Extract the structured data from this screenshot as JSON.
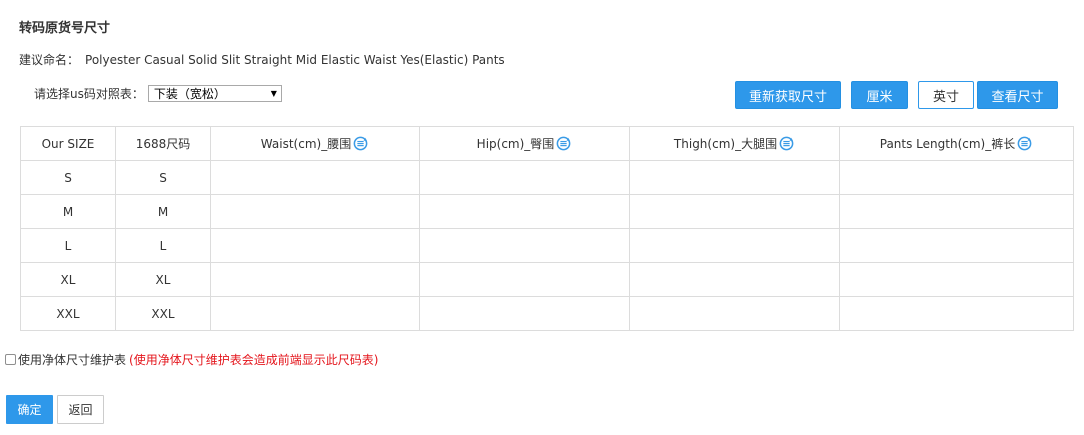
{
  "title": "转码原货号尺寸",
  "suggest": {
    "label": "建议命名：",
    "value": "Polyester Casual Solid Slit Straight Mid Elastic Waist Yes(Elastic) Pants"
  },
  "size_chart_select": {
    "label": "请选择us码对照表：",
    "selected": "下装（宽松）"
  },
  "buttons": {
    "refetch": "重新获取尺寸",
    "cm": "厘米",
    "inch": "英寸",
    "view": "查看尺寸"
  },
  "table": {
    "headers": [
      "Our SIZE",
      "1688尺码",
      "Waist(cm)_腰围",
      "Hip(cm)_臀围",
      "Thigh(cm)_大腿围",
      "Pants Length(cm)_裤长"
    ],
    "rows": [
      [
        "S",
        "S",
        "",
        "",
        "",
        ""
      ],
      [
        "M",
        "M",
        "",
        "",
        "",
        ""
      ],
      [
        "L",
        "L",
        "",
        "",
        "",
        ""
      ],
      [
        "XL",
        "XL",
        "",
        "",
        "",
        ""
      ],
      [
        "XXL",
        "XXL",
        "",
        "",
        "",
        ""
      ]
    ]
  },
  "net_size": {
    "label": "使用净体尺寸维护表",
    "warning": "(使用净体尺寸维护表会造成前端显示此尺码表)",
    "checked": false
  },
  "footer": {
    "confirm": "确定",
    "back": "返回"
  },
  "colors": {
    "accent": "#2e98ea",
    "warning": "#e4141b",
    "border": "#dcdcdc"
  }
}
